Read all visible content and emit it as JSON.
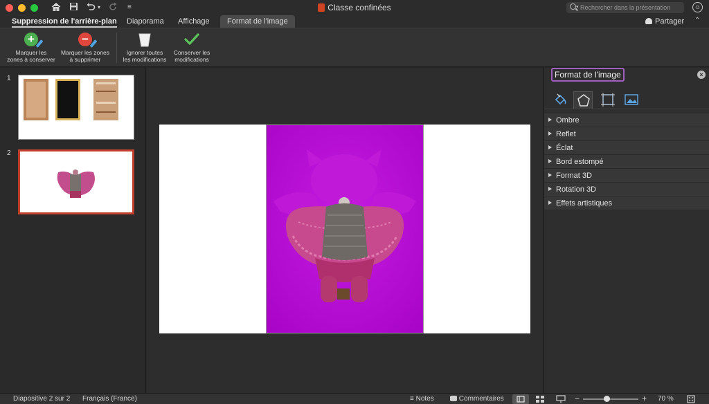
{
  "window": {
    "title": "Classe confinées",
    "search_placeholder": "Rechercher dans la présentation"
  },
  "tabs": [
    {
      "label": "Suppression de l'arrière-plan",
      "active": true
    },
    {
      "label": "Diaporama"
    },
    {
      "label": "Affichage"
    },
    {
      "label": "Format de l'image",
      "contextual": true
    }
  ],
  "share_label": "Partager",
  "ribbon": {
    "mark_keep": {
      "line1": "Marquer les",
      "line2": "zones à conserver"
    },
    "mark_remove": {
      "line1": "Marquer les zones",
      "line2": "à supprimer"
    },
    "discard": {
      "line1": "Ignorer toutes",
      "line2": "les modifications"
    },
    "keep_changes": {
      "line1": "Conserver les",
      "line2": "modifications"
    }
  },
  "slides": [
    {
      "number": "1"
    },
    {
      "number": "2",
      "selected": true
    }
  ],
  "format_pane": {
    "title": "Format de l'image",
    "tabs": [
      "fill-icon",
      "shape-effects-icon",
      "size-properties-icon",
      "picture-icon"
    ],
    "sections": [
      "Ombre",
      "Reflet",
      "Éclat",
      "Bord estompé",
      "Format 3D",
      "Rotation 3D",
      "Effets artistiques"
    ]
  },
  "status": {
    "slide_info": "Diapositive 2 sur 2",
    "language": "Français (France)",
    "notes": "Notes",
    "comments": "Commentaires",
    "zoom_label": "70 %",
    "zoom_level": 0.7
  },
  "colors": {
    "removal_overlay": "#b60ad6",
    "selected_slide_border": "#c0402b",
    "pane_title_focus": "#9f5fbf"
  }
}
